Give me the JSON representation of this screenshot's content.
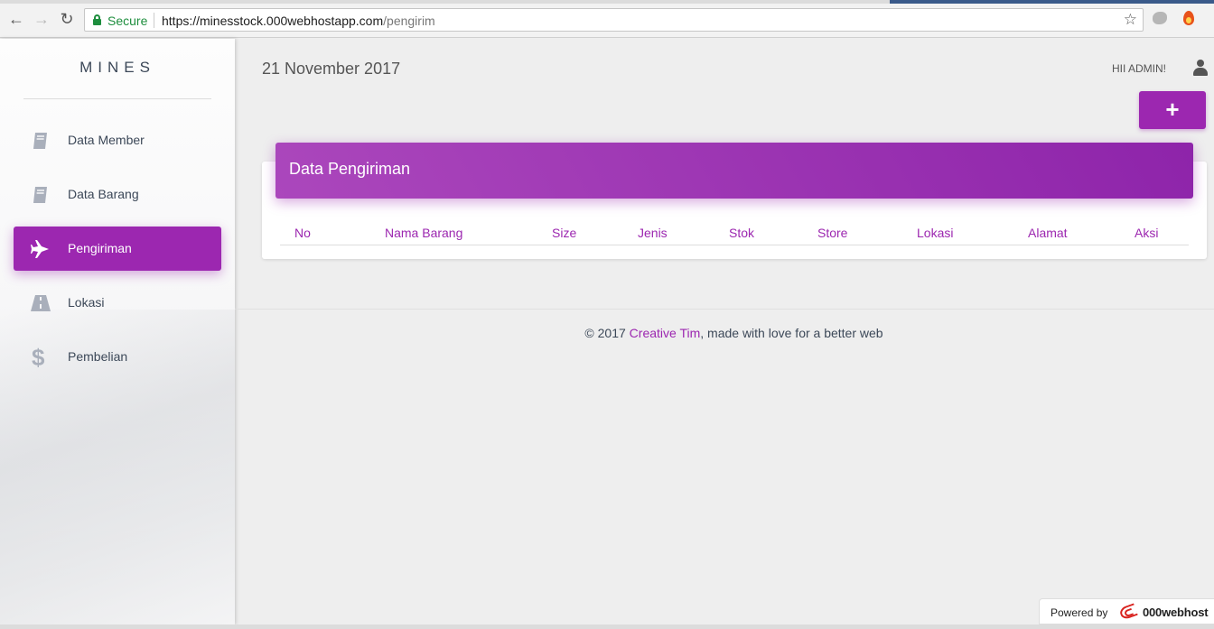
{
  "browser": {
    "secure_label": "Secure",
    "url_host": "https://minesstock.000webhostapp.com",
    "url_path": "/pengirim"
  },
  "sidebar": {
    "logo": "MINES",
    "items": [
      {
        "label": "Data Member",
        "icon": "book-icon"
      },
      {
        "label": "Data Barang",
        "icon": "book-icon"
      },
      {
        "label": "Pengiriman",
        "icon": "plane-icon",
        "active": true
      },
      {
        "label": "Lokasi",
        "icon": "road-icon"
      },
      {
        "label": "Pembelian",
        "icon": "dollar-icon"
      }
    ]
  },
  "header": {
    "date": "21 November 2017",
    "greeting": "HII ADMIN!",
    "add_button": "+"
  },
  "card": {
    "title": "Data Pengiriman",
    "columns": [
      "No",
      "Nama Barang",
      "Size",
      "Jenis",
      "Stok",
      "Store",
      "Lokasi",
      "Alamat",
      "Aksi"
    ],
    "rows": []
  },
  "footer": {
    "prefix": "© 2017 ",
    "brand": "Creative Tim",
    "suffix": ", made with love for a better web"
  },
  "powered": {
    "label": "Powered by",
    "brand": "000webhost"
  },
  "colors": {
    "accent": "#9c27b0"
  }
}
